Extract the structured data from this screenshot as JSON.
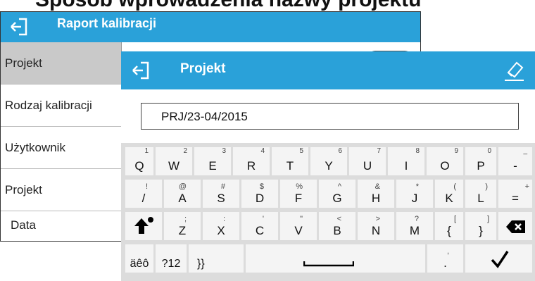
{
  "heading": "Sposób wprowadzenia nazwy projektu",
  "background_window": {
    "title": "Raport kalibracji",
    "items": [
      "Projekt",
      "Rodzaj kalibracji",
      "Użytkownik",
      "Projekt",
      "Data"
    ]
  },
  "dialog": {
    "title": "Projekt",
    "input_value": "PRJ/23-04/2015"
  },
  "keyboard": {
    "row1": [
      {
        "main": "Q",
        "sup": "1"
      },
      {
        "main": "W",
        "sup": "2"
      },
      {
        "main": "E",
        "sup": "3"
      },
      {
        "main": "R",
        "sup": "4"
      },
      {
        "main": "T",
        "sup": "5"
      },
      {
        "main": "Y",
        "sup": "6"
      },
      {
        "main": "U",
        "sup": "7"
      },
      {
        "main": "I",
        "sup": "8"
      },
      {
        "main": "O",
        "sup": "9"
      },
      {
        "main": "P",
        "sup": "0"
      },
      {
        "main": "-",
        "sup": "_"
      }
    ],
    "row2": [
      {
        "main": "/",
        "sup": "!"
      },
      {
        "main": "A",
        "sup": "@"
      },
      {
        "main": "S",
        "sup": "#"
      },
      {
        "main": "D",
        "sup": "$"
      },
      {
        "main": "F",
        "sup": "%"
      },
      {
        "main": "G",
        "sup": "^"
      },
      {
        "main": "H",
        "sup": "&"
      },
      {
        "main": "J",
        "sup": "*"
      },
      {
        "main": "K",
        "sup": "("
      },
      {
        "main": "L",
        "sup": ")"
      },
      {
        "main": "=",
        "sup": "+"
      }
    ],
    "row3": [
      {
        "main": "Z",
        "sup": ";"
      },
      {
        "main": "X",
        "sup": ":"
      },
      {
        "main": "C",
        "sup": "'"
      },
      {
        "main": "V",
        "sup": "\""
      },
      {
        "main": "B",
        "sup": "<"
      },
      {
        "main": "N",
        "sup": ">"
      },
      {
        "main": "M",
        "sup": "?"
      },
      {
        "main": "{",
        "sup": "["
      },
      {
        "main": "}",
        "sup": "]"
      }
    ],
    "accents_label": "äêô",
    "numbers_label": "?12",
    "symbols_label": "}}",
    "dot_label": ".",
    "dot_sup": ","
  },
  "icons": {
    "back": "back-arrow-icon",
    "eraser": "eraser-icon",
    "shift": "shift-icon",
    "backspace": "backspace-icon",
    "space": "space-bar-icon",
    "enter": "checkmark-icon"
  },
  "colors": {
    "header": "#2aa1d9",
    "keyboard_bg": "#dcdcdc",
    "key": "#f4f4f4"
  }
}
